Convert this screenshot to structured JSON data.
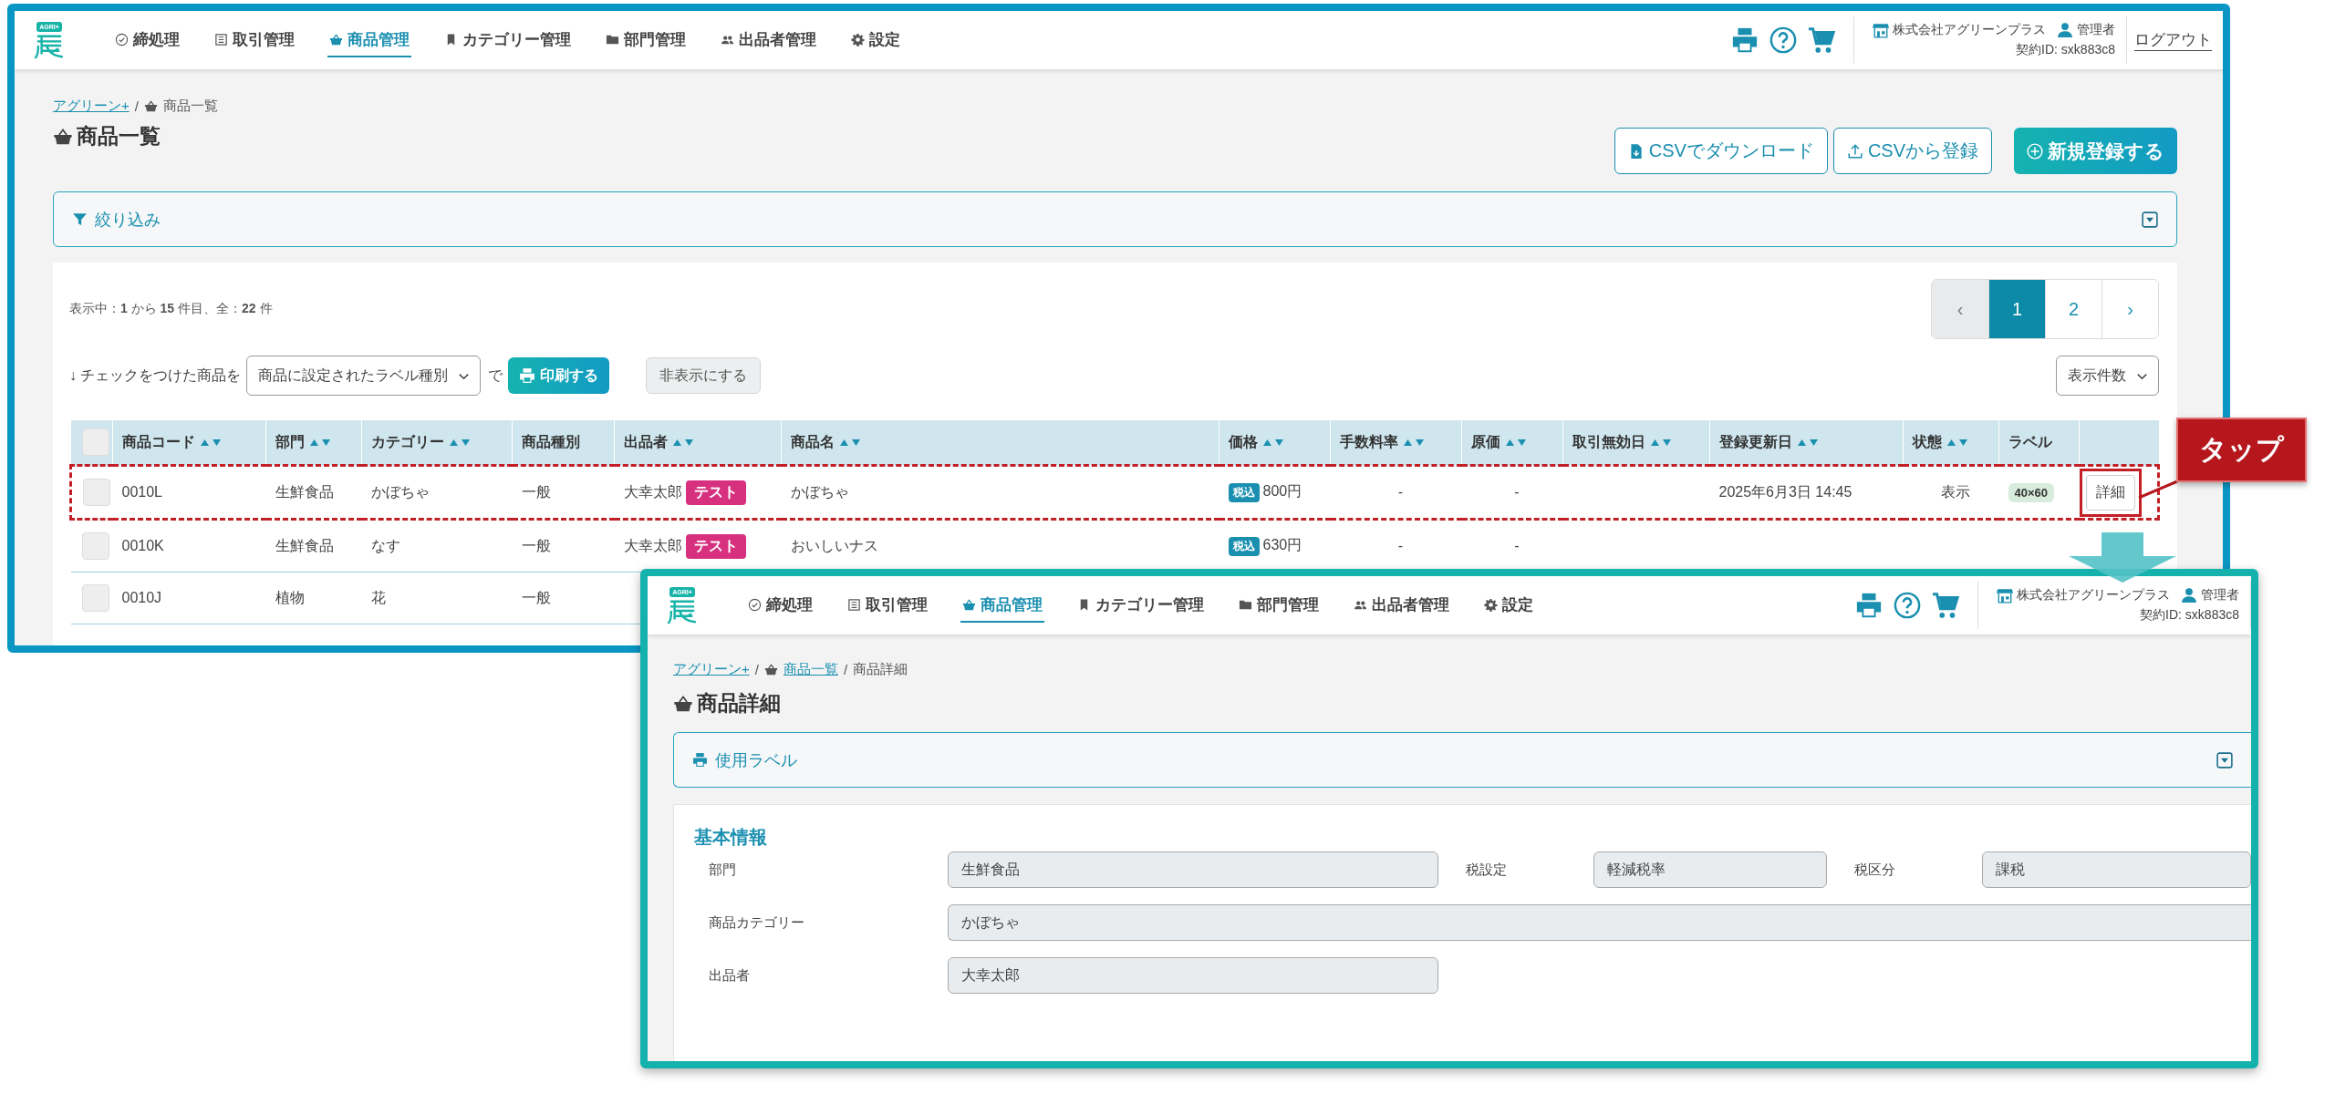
{
  "list_screen": {
    "nav": {
      "logo_text": "AGRI+",
      "items": [
        {
          "label": "締処理",
          "selected": false
        },
        {
          "label": "取引管理",
          "selected": false
        },
        {
          "label": "商品管理",
          "selected": true
        },
        {
          "label": "カテゴリー管理",
          "selected": false
        },
        {
          "label": "部門管理",
          "selected": false
        },
        {
          "label": "出品者管理",
          "selected": false
        },
        {
          "label": "設定",
          "selected": false
        }
      ],
      "company": "株式会社アグリーンプラス",
      "role": "管理者",
      "contract": "契約ID: sxk883c8",
      "logout": "ログアウト"
    },
    "breadcrumb": [
      {
        "kind": "link",
        "label": "アグリーン+"
      },
      {
        "kind": "separator",
        "label": "/"
      },
      {
        "kind": "current",
        "label": "商品一覧"
      }
    ],
    "title": "商品一覧",
    "actions": [
      {
        "kind": "outline",
        "label": "CSVでダウンロード"
      },
      {
        "kind": "outline",
        "label": "CSVから登録"
      },
      {
        "kind": "primary",
        "label": "新規登録する"
      }
    ],
    "panel": {
      "label": "絞り込み"
    },
    "summary": "表示中：**1** から **15** 件目、全：**22** 件",
    "pagination": [
      {
        "label": "‹",
        "selected": false,
        "disabled": true
      },
      {
        "label": "1",
        "selected": true,
        "disabled": false
      },
      {
        "label": "2",
        "selected": false,
        "disabled": false
      },
      {
        "label": "›",
        "selected": false,
        "disabled": false
      }
    ],
    "bulk": {
      "prefix": "↓ チェックをつけた商品を",
      "select": "商品に設定されたラベル種別",
      "joiner": "で",
      "print": "印刷する",
      "hide": "非表示にする"
    },
    "per_page": "表示件数",
    "columns": [
      {
        "kind": "checkbox",
        "checked": false
      },
      {
        "kind": "text",
        "label": "商品コード",
        "sortable": true
      },
      {
        "kind": "text",
        "label": "部門",
        "sortable": true
      },
      {
        "kind": "text",
        "label": "カテゴリー",
        "sortable": true
      },
      {
        "kind": "text",
        "label": "商品種別",
        "sortable": false
      },
      {
        "kind": "text",
        "label": "出品者",
        "sortable": true
      },
      {
        "kind": "text",
        "label": "商品名",
        "sortable": true
      },
      {
        "kind": "text",
        "label": "価格",
        "sortable": true
      },
      {
        "kind": "text",
        "label": "手数料率",
        "sortable": true
      },
      {
        "kind": "text",
        "label": "原価",
        "sortable": true
      },
      {
        "kind": "text",
        "label": "取引無効日",
        "sortable": true
      },
      {
        "kind": "text",
        "label": "登録更新日",
        "sortable": true
      },
      {
        "kind": "text",
        "label": "状態",
        "sortable": true
      },
      {
        "kind": "text",
        "label": "ラベル",
        "sortable": false
      },
      {
        "kind": "blank"
      }
    ],
    "rows": [
      {
        "highlighted": true,
        "checked": false,
        "code": "0010L",
        "department": "生鮮食品",
        "category": "かぼちゃ",
        "type": "一般",
        "seller": "大幸太郎",
        "seller_tag": "テスト",
        "name": "かぼちゃ",
        "tax_badge": "税込",
        "price": "800円",
        "fee": "-",
        "cost": "-",
        "updated": "2025年6月3日 14:45",
        "status": "表示",
        "label": "40×60",
        "action": {
          "label": "詳細",
          "marked": true
        }
      },
      {
        "highlighted": false,
        "checked": false,
        "code": "0010K",
        "department": "生鮮食品",
        "category": "なす",
        "type": "一般",
        "seller": "大幸太郎",
        "seller_tag": "テスト",
        "name": "おいしいナス",
        "tax_badge": "税込",
        "price": "630円",
        "fee": "-",
        "cost": "-"
      },
      {
        "highlighted": false,
        "checked": false,
        "code": "0010J",
        "department": "植物",
        "category": "花",
        "type": "一般"
      }
    ]
  },
  "detail_screen": {
    "nav": {
      "logo_text": "AGRI+",
      "items": [
        {
          "label": "締処理",
          "selected": false
        },
        {
          "label": "取引管理",
          "selected": false
        },
        {
          "label": "商品管理",
          "selected": true
        },
        {
          "label": "カテゴリー管理",
          "selected": false
        },
        {
          "label": "部門管理",
          "selected": false
        },
        {
          "label": "出品者管理",
          "selected": false
        },
        {
          "label": "設定",
          "selected": false
        }
      ],
      "company": "株式会社アグリーンプラス",
      "role": "管理者",
      "contract": "契約ID: sxk883c8"
    },
    "breadcrumb": [
      {
        "kind": "link",
        "label": "アグリーン+"
      },
      {
        "kind": "separator",
        "label": "/"
      },
      {
        "kind": "link",
        "label": "商品一覧"
      },
      {
        "kind": "separator",
        "label": "/"
      },
      {
        "kind": "current",
        "label": "商品詳細"
      }
    ],
    "title": "商品詳細",
    "panel": {
      "label": "使用ラベル"
    },
    "section": {
      "title": "基本情報",
      "rows": [
        [
          {
            "label": "部門",
            "value": "生鮮食品"
          },
          {
            "label": "税設定",
            "value": "軽減税率"
          },
          {
            "label": "税区分",
            "value": "課税"
          }
        ],
        [
          {
            "label": "商品カテゴリー",
            "value": "かぼちゃ"
          }
        ],
        [
          {
            "label": "出品者",
            "value": "大幸太郎"
          }
        ]
      ]
    }
  },
  "callout": {
    "text": "タップ"
  }
}
